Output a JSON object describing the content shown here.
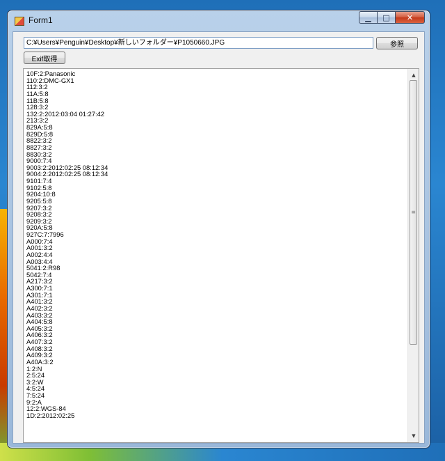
{
  "window": {
    "title": "Form1",
    "min_glyph": "▁",
    "max_glyph": "□",
    "close_glyph": "✕"
  },
  "toolbar": {
    "path_value": "C:¥Users¥Penguin¥Desktop¥新しいフォルダー¥P1050660.JPG",
    "browse_label": "参照",
    "exif_label": "Exif取得"
  },
  "output": {
    "lines": [
      "10F:2:Panasonic",
      "110:2:DMC-GX1",
      "112:3:2",
      "11A:5:8",
      "11B:5:8",
      "128:3:2",
      "132:2:2012:03:04 01:27:42",
      "213:3:2",
      "829A:5:8",
      "829D:5:8",
      "8822:3:2",
      "8827:3:2",
      "8830:3:2",
      "9000:7:4",
      "9003:2:2012:02:25 08:12:34",
      "9004:2:2012:02:25 08:12:34",
      "9101:7:4",
      "9102:5:8",
      "9204:10:8",
      "9205:5:8",
      "9207:3:2",
      "9208:3:2",
      "9209:3:2",
      "920A:5:8",
      "927C:7:7996",
      "A000:7:4",
      "A001:3:2",
      "A002:4:4",
      "A003:4:4",
      "5041:2:R98",
      "5042:7:4",
      "A217:3:2",
      "A300:7:1",
      "A301:7:1",
      "A401:3:2",
      "A402:3:2",
      "A403:3:2",
      "A404:5:8",
      "A405:3:2",
      "A406:3:2",
      "A407:3:2",
      "A408:3:2",
      "A409:3:2",
      "A40A:3:2",
      "1:2:N",
      "2:5:24",
      "3:2:W",
      "4:5:24",
      "7:5:24",
      "9:2:A",
      "12:2:WGS-84",
      "1D:2:2012:02:25"
    ]
  },
  "scrollbar": {
    "up_glyph": "▲",
    "down_glyph": "▼",
    "grip_glyph": "≡"
  }
}
